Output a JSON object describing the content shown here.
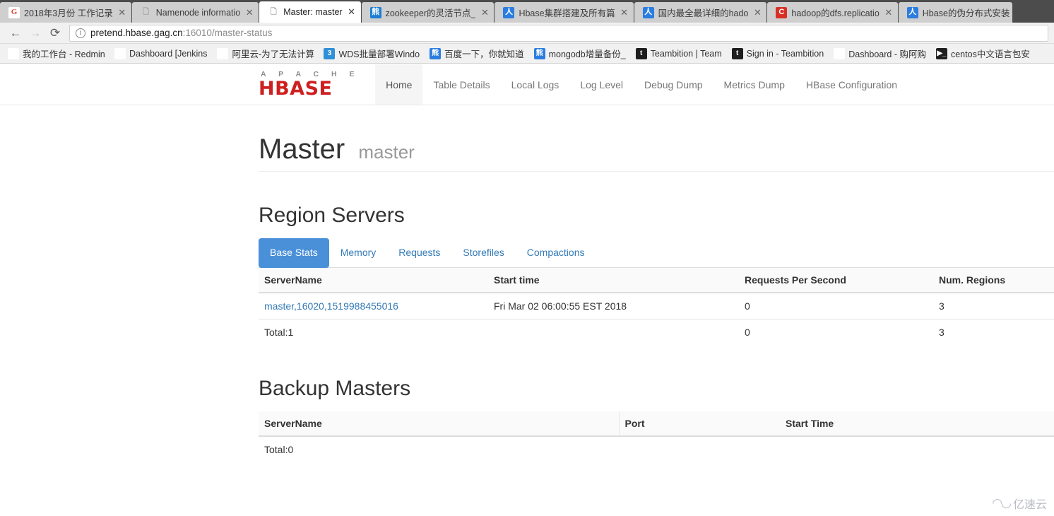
{
  "browser": {
    "tabs": [
      {
        "title": "2018年3月份 工作记录",
        "icon": "google-favicon",
        "icon_glyph": "G",
        "icon_class": "fav-g",
        "active": false
      },
      {
        "title": "Namenode informatio",
        "icon": "page-favicon",
        "icon_glyph": "🗋",
        "icon_class": "fav-page",
        "active": false
      },
      {
        "title": "Master: master",
        "icon": "page-favicon",
        "icon_glyph": "🗋",
        "icon_class": "fav-page",
        "active": true
      },
      {
        "title": "zookeeper的灵活节点_",
        "icon": "zookeeper-favicon",
        "icon_glyph": "熊",
        "icon_class": "fav-zk",
        "active": false
      },
      {
        "title": "Hbase集群搭建及所有篇",
        "icon": "blog-favicon",
        "icon_glyph": "人",
        "icon_class": "fav-blue",
        "active": false
      },
      {
        "title": "国内最全最详细的hado",
        "icon": "blog-favicon",
        "icon_glyph": "人",
        "icon_class": "fav-blue",
        "active": false
      },
      {
        "title": "hadoop的dfs.replicatio",
        "icon": "csdn-favicon",
        "icon_glyph": "C",
        "icon_class": "fav-red",
        "active": false
      },
      {
        "title": "Hbase的伪分布式安装",
        "icon": "blog-favicon",
        "icon_glyph": "人",
        "icon_class": "fav-blue",
        "active": false
      }
    ],
    "tab_close_glyph": "✕",
    "nav": {
      "back_glyph": "←",
      "forward_glyph": "→",
      "reload_glyph": "⟳"
    },
    "omnibox": {
      "info_glyph": "i",
      "url_host": "pretend.hbase.gag.cn",
      "url_rest": ":16010/master-status",
      "full_url": "pretend.hbase.gag.cn:16010/master-status"
    },
    "bookmarks": [
      {
        "label": "我的工作台 - Redmin",
        "icon": "redmine-icon",
        "glyph": "∩",
        "cls": "ic-redmine"
      },
      {
        "label": "Dashboard [Jenkins",
        "icon": "jenkins-icon",
        "glyph": "☻",
        "cls": "ic-jenkins"
      },
      {
        "label": "阿里云-为了无法计算",
        "icon": "aliyun-icon",
        "glyph": "[]",
        "cls": "ic-aliyun"
      },
      {
        "label": "WDS批量部署Windo",
        "icon": "wds-icon",
        "glyph": "3",
        "cls": "ic-wds"
      },
      {
        "label": "百度一下，你就知道",
        "icon": "baidu-icon",
        "glyph": "熊",
        "cls": "ic-baidu"
      },
      {
        "label": "mongodb增量备份_",
        "icon": "mongodb-icon",
        "glyph": "熊",
        "cls": "ic-mongo"
      },
      {
        "label": "Teambition | Team",
        "icon": "teambition-icon",
        "glyph": "t",
        "cls": "ic-team"
      },
      {
        "label": "Sign in - Teambition",
        "icon": "teambition-icon",
        "glyph": "t",
        "cls": "ic-team"
      },
      {
        "label": "Dashboard - 购阿购",
        "icon": "google-icon",
        "glyph": "G",
        "cls": "ic-dash"
      },
      {
        "label": "centos中文语言包安",
        "icon": "terminal-icon",
        "glyph": "▶_",
        "cls": "ic-centos"
      }
    ]
  },
  "navbar": {
    "brand_top": "A P A C H E",
    "brand_main": "HBASE",
    "items": [
      {
        "label": "Home",
        "active": true
      },
      {
        "label": "Table Details",
        "active": false
      },
      {
        "label": "Local Logs",
        "active": false
      },
      {
        "label": "Log Level",
        "active": false
      },
      {
        "label": "Debug Dump",
        "active": false
      },
      {
        "label": "Metrics Dump",
        "active": false
      },
      {
        "label": "HBase Configuration",
        "active": false
      }
    ]
  },
  "page": {
    "title": "Master",
    "subtitle": "master"
  },
  "region_servers": {
    "heading": "Region Servers",
    "tabs": [
      {
        "label": "Base Stats",
        "active": true
      },
      {
        "label": "Memory",
        "active": false
      },
      {
        "label": "Requests",
        "active": false
      },
      {
        "label": "Storefiles",
        "active": false
      },
      {
        "label": "Compactions",
        "active": false
      }
    ],
    "columns": [
      "ServerName",
      "Start time",
      "Requests Per Second",
      "Num. Regions"
    ],
    "rows": [
      {
        "server_name": "master,16020,1519988455016",
        "start_time": "Fri Mar 02 06:00:55 EST 2018",
        "requests_per_second": "0",
        "num_regions": "3"
      }
    ],
    "total_row": {
      "label": "Total:1",
      "start_time": "",
      "requests_per_second": "0",
      "num_regions": "3"
    }
  },
  "backup_masters": {
    "heading": "Backup Masters",
    "columns": [
      "ServerName",
      "Port",
      "Start Time"
    ],
    "rows": [],
    "total_row": {
      "label": "Total:0",
      "port": "",
      "start_time": ""
    }
  },
  "watermark": {
    "cloud_glyph": "◠◡",
    "text": "亿速云"
  },
  "colors": {
    "brand_red": "#ce2020",
    "link_blue": "#337ab7",
    "active_tab_blue": "#4a90d9",
    "chrome_dark": "#4c4c4c",
    "nav_text": "#777777"
  }
}
